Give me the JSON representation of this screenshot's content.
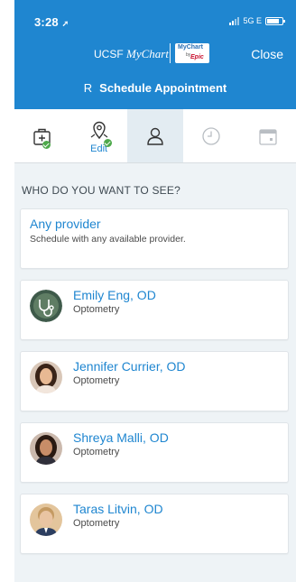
{
  "status": {
    "time": "3:28",
    "network": "5G E"
  },
  "header": {
    "brand_ucsf": "UCSF",
    "brand_mychart": "MyChart",
    "logo_mychart": "MyChart",
    "logo_by": "by",
    "logo_epic": "Epic",
    "close_label": "Close",
    "initial": "R",
    "title": "Schedule Appointment"
  },
  "steps": [
    {
      "name": "reason",
      "icon": "medical-kit-icon",
      "complete": true
    },
    {
      "name": "location",
      "icon": "map-pin-icon",
      "complete": true,
      "edit_label": "Edit"
    },
    {
      "name": "provider",
      "icon": "person-icon",
      "active": true
    },
    {
      "name": "time",
      "icon": "clock-icon",
      "disabled": true
    },
    {
      "name": "date",
      "icon": "calendar-icon",
      "disabled": true
    }
  ],
  "question": "WHO DO YOU WANT TO SEE?",
  "any_provider": {
    "title": "Any provider",
    "subtitle": "Schedule with any available provider."
  },
  "providers": [
    {
      "name": "Emily Eng, OD",
      "specialty": "Optometry",
      "avatar": "stethoscope-avatar"
    },
    {
      "name": "Jennifer Currier, OD",
      "specialty": "Optometry",
      "avatar": "photo-woman-dark-hair"
    },
    {
      "name": "Shreya Malli, OD",
      "specialty": "Optometry",
      "avatar": "photo-woman-dark-hair"
    },
    {
      "name": "Taras Litvin, OD",
      "specialty": "Optometry",
      "avatar": "photo-man-light-hair"
    }
  ],
  "colors": {
    "brand_blue": "#1f86d0",
    "check_green": "#4ea94b",
    "background": "#eef3f6"
  }
}
